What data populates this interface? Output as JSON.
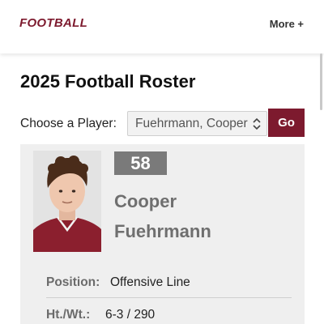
{
  "header": {
    "brand": "FOOTBALL",
    "more_label": "More +"
  },
  "page": {
    "title": "2025 Football Roster"
  },
  "chooser": {
    "label": "Choose a Player:",
    "selected": "Fuehrmann, Cooper",
    "go_label": "Go"
  },
  "player": {
    "number": "58",
    "first_name": "Cooper",
    "last_name": "Fuehrmann",
    "position_label": "Position:",
    "position": "Offensive Line",
    "htwt_label": "Ht./Wt.:",
    "htwt": "6-3 / 290"
  },
  "colors": {
    "accent": "#7d1a2e",
    "jersey_badge": "#7a7a7a",
    "card_bg": "#efefef"
  }
}
